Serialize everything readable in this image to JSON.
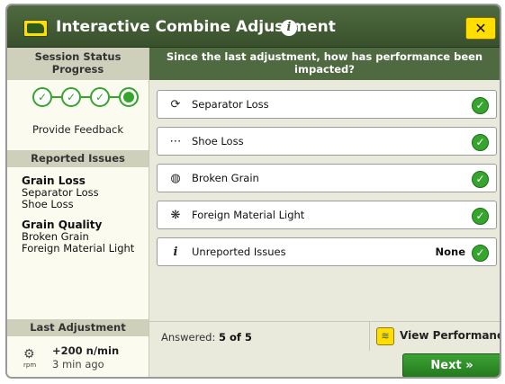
{
  "dialog": {
    "title": "Interactive Combine Adjustment",
    "info_icon": "info-icon",
    "close_label": "✕",
    "brand_color": "#4f6a40",
    "accent_color": "#ffde00"
  },
  "sidebar": {
    "session_status": "Session Status",
    "progress_label": "Progress",
    "progress": {
      "total_steps": 4,
      "completed_steps": 3,
      "current_step": 4
    },
    "feedback_label": "Provide Feedback",
    "reported_issues_title": "Reported Issues",
    "groups": [
      {
        "name": "Grain Loss",
        "items": [
          "Separator Loss",
          "Shoe Loss"
        ]
      },
      {
        "name": "Grain Quality",
        "items": [
          "Broken Grain",
          "Foreign Material Light"
        ]
      }
    ],
    "last_adjustment": {
      "title": "Last Adjustment",
      "icon": "rotor-speed-icon",
      "icon_unit": "rpm",
      "value": "+200 n/min",
      "ago": "3 min ago"
    }
  },
  "main": {
    "question": "Since the last adjustment, how has performance been impacted?",
    "options": [
      {
        "icon": "separator-loss-icon",
        "glyph": "⟳",
        "label": "Separator Loss",
        "status": "checked"
      },
      {
        "icon": "shoe-loss-icon",
        "glyph": "⋯",
        "label": "Shoe Loss",
        "status": "checked"
      },
      {
        "icon": "broken-grain-icon",
        "glyph": "◍",
        "label": "Broken Grain",
        "status": "checked"
      },
      {
        "icon": "foreign-material-icon",
        "glyph": "❋",
        "label": "Foreign Material Light",
        "status": "checked"
      },
      {
        "icon": "unreported-issues-icon",
        "glyph": "i",
        "label": "Unreported Issues",
        "status": "checked",
        "value": "None"
      }
    ],
    "answered_prefix": "Answered:",
    "answered_value": "5 of 5",
    "view_performance_label": "View Performance",
    "next_label": "Next »"
  }
}
